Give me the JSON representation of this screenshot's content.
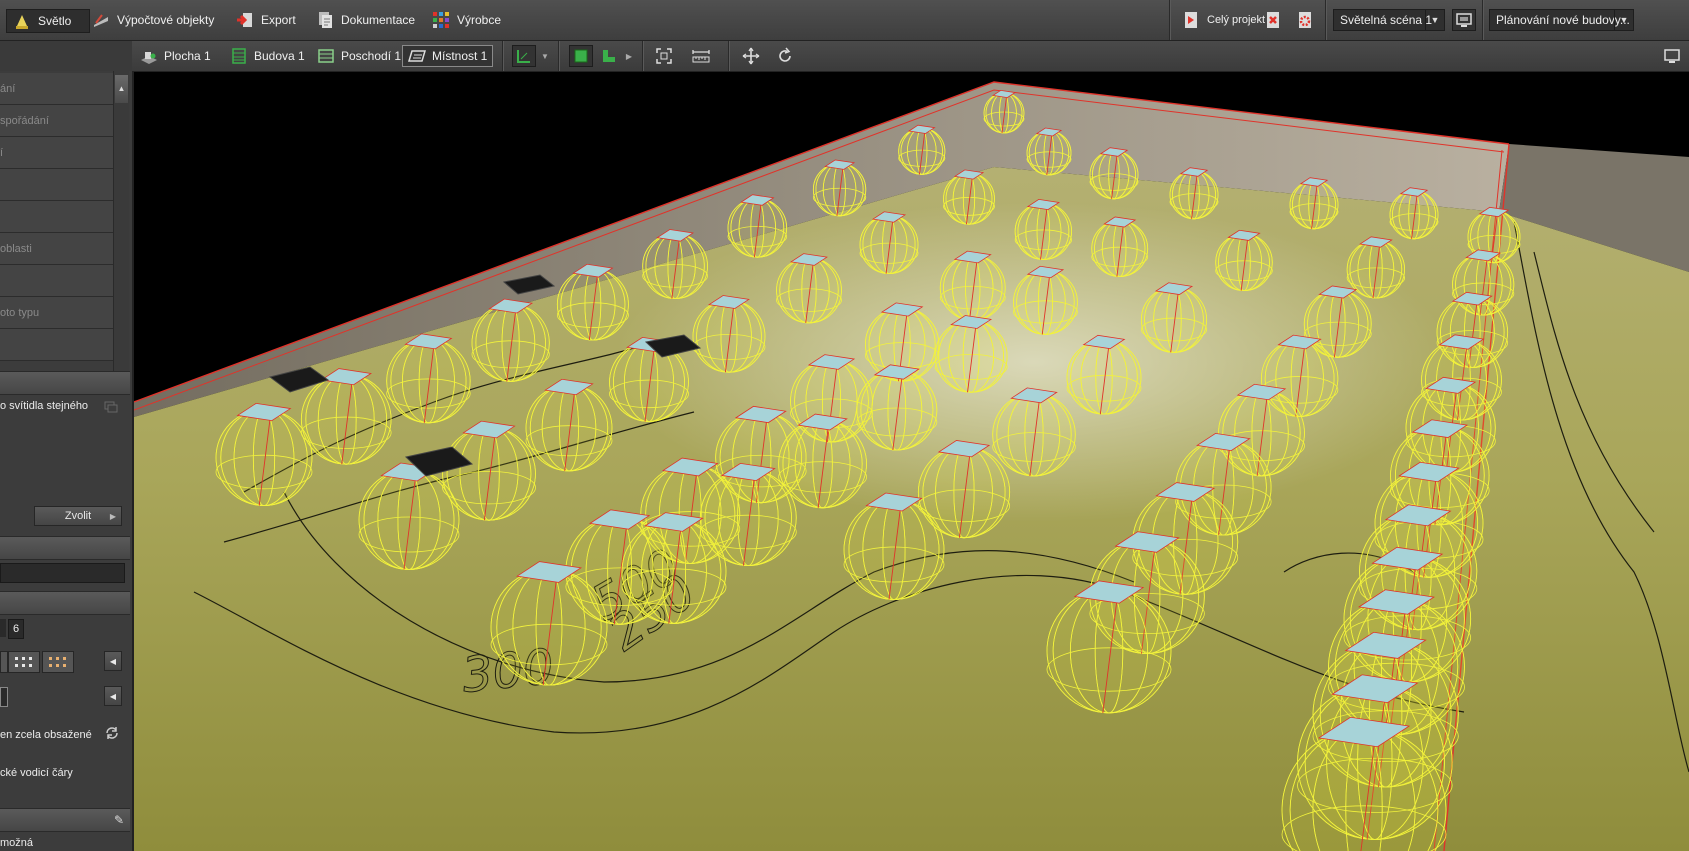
{
  "topbar": {
    "tabs": [
      {
        "label": "Světlo",
        "icon": "light-icon",
        "active": true
      },
      {
        "label": "Výpočtové objekty",
        "icon": "calc-objects-icon",
        "active": false
      },
      {
        "label": "Export",
        "icon": "export-icon",
        "active": false
      },
      {
        "label": "Dokumentace",
        "icon": "documentation-icon",
        "active": false
      },
      {
        "label": "Výrobce",
        "icon": "manufacturer-icon",
        "active": false
      }
    ],
    "project_label": "Celý projekt",
    "scene_select": "Světelná scéna 1",
    "planning_select": "Plánování nové budovy..."
  },
  "breadcrumb": {
    "items": [
      "Plocha 1",
      "Budova 1",
      "Poschodí 1",
      "Místnost 1"
    ],
    "active_index": 3
  },
  "left_panel": {
    "dim_rows": [
      "ání",
      "spořádání",
      "í",
      "",
      "",
      "oblasti",
      "",
      "oto typu",
      ""
    ],
    "option_text": "o svítidla stejného",
    "choose_button": "Zvolit",
    "count_value": "6",
    "contained_text": "en zcela obsažené",
    "guides_text": "cké vodicí čáry",
    "bottom_text": "možná"
  },
  "viewport": {
    "labels": [
      "500",
      "300",
      "250"
    ],
    "colors": {
      "sky": "#000000",
      "floor": "#9c9a48",
      "wall": "#8a8172",
      "luminaire_wire": "#f2f23c",
      "luminaire_panel": "#a7d3d8",
      "room_outline": "#e0332a"
    }
  }
}
